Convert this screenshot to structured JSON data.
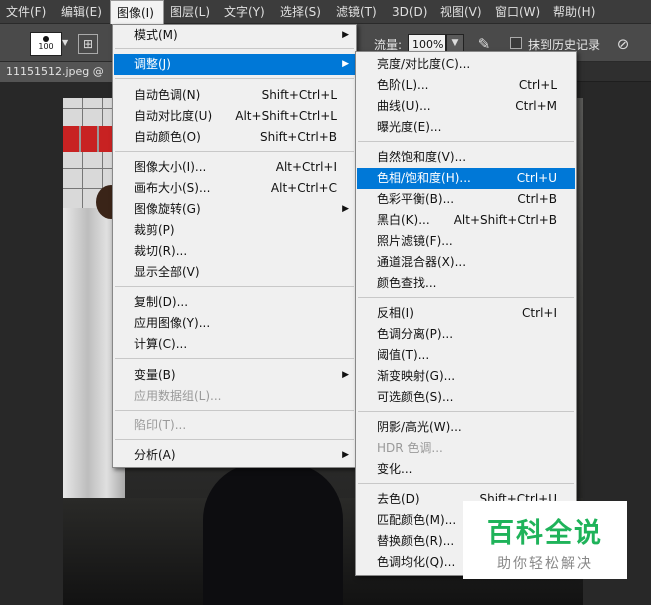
{
  "menubar": {
    "items": [
      "文件(F)",
      "编辑(E)",
      "图像(I)",
      "图层(L)",
      "文字(Y)",
      "选择(S)",
      "滤镜(T)",
      "3D(D)",
      "视图(V)",
      "窗口(W)",
      "帮助(H)"
    ]
  },
  "options": {
    "brush_size": "100",
    "flow_label": "流量:",
    "flow_value": "100%",
    "history_label": "抹到历史记录"
  },
  "document": {
    "tab_title": "11151512.jpeg @"
  },
  "image_menu": {
    "items": [
      {
        "label": "模式(M)",
        "shortcut": "",
        "submenu": true
      },
      {
        "label": "调整(J)",
        "shortcut": "",
        "submenu": true
      },
      {
        "label": "自动色调(N)",
        "shortcut": "Shift+Ctrl+L"
      },
      {
        "label": "自动对比度(U)",
        "shortcut": "Alt+Shift+Ctrl+L"
      },
      {
        "label": "自动颜色(O)",
        "shortcut": "Shift+Ctrl+B"
      },
      {
        "label": "图像大小(I)...",
        "shortcut": "Alt+Ctrl+I"
      },
      {
        "label": "画布大小(S)...",
        "shortcut": "Alt+Ctrl+C"
      },
      {
        "label": "图像旋转(G)",
        "shortcut": "",
        "submenu": true
      },
      {
        "label": "裁剪(P)",
        "shortcut": ""
      },
      {
        "label": "裁切(R)...",
        "shortcut": ""
      },
      {
        "label": "显示全部(V)",
        "shortcut": ""
      },
      {
        "label": "复制(D)...",
        "shortcut": ""
      },
      {
        "label": "应用图像(Y)...",
        "shortcut": ""
      },
      {
        "label": "计算(C)...",
        "shortcut": ""
      },
      {
        "label": "变量(B)",
        "shortcut": "",
        "submenu": true
      },
      {
        "label": "应用数据组(L)...",
        "shortcut": ""
      },
      {
        "label": "陷印(T)...",
        "shortcut": ""
      },
      {
        "label": "分析(A)",
        "shortcut": "",
        "submenu": true
      }
    ]
  },
  "adjust_menu": {
    "items": [
      {
        "label": "亮度/对比度(C)...",
        "shortcut": ""
      },
      {
        "label": "色阶(L)...",
        "shortcut": "Ctrl+L"
      },
      {
        "label": "曲线(U)...",
        "shortcut": "Ctrl+M"
      },
      {
        "label": "曝光度(E)...",
        "shortcut": ""
      },
      {
        "label": "自然饱和度(V)...",
        "shortcut": ""
      },
      {
        "label": "色相/饱和度(H)...",
        "shortcut": "Ctrl+U"
      },
      {
        "label": "色彩平衡(B)...",
        "shortcut": "Ctrl+B"
      },
      {
        "label": "黑白(K)...",
        "shortcut": "Alt+Shift+Ctrl+B"
      },
      {
        "label": "照片滤镜(F)...",
        "shortcut": ""
      },
      {
        "label": "通道混合器(X)...",
        "shortcut": ""
      },
      {
        "label": "颜色查找...",
        "shortcut": ""
      },
      {
        "label": "反相(I)",
        "shortcut": "Ctrl+I"
      },
      {
        "label": "色调分离(P)...",
        "shortcut": ""
      },
      {
        "label": "阈值(T)...",
        "shortcut": ""
      },
      {
        "label": "渐变映射(G)...",
        "shortcut": ""
      },
      {
        "label": "可选颜色(S)...",
        "shortcut": ""
      },
      {
        "label": "阴影/高光(W)...",
        "shortcut": ""
      },
      {
        "label": "HDR 色调...",
        "shortcut": ""
      },
      {
        "label": "变化...",
        "shortcut": ""
      },
      {
        "label": "去色(D)",
        "shortcut": "Shift+Ctrl+U"
      },
      {
        "label": "匹配颜色(M)...",
        "shortcut": ""
      },
      {
        "label": "替换颜色(R)...",
        "shortcut": ""
      },
      {
        "label": "色调均化(Q)...",
        "shortcut": ""
      }
    ]
  },
  "watermark": {
    "title": "百科全说",
    "subtitle": "助你轻松解决"
  },
  "colors": {
    "highlight": "#0078d7",
    "watermark_green": "#1fb35a"
  }
}
